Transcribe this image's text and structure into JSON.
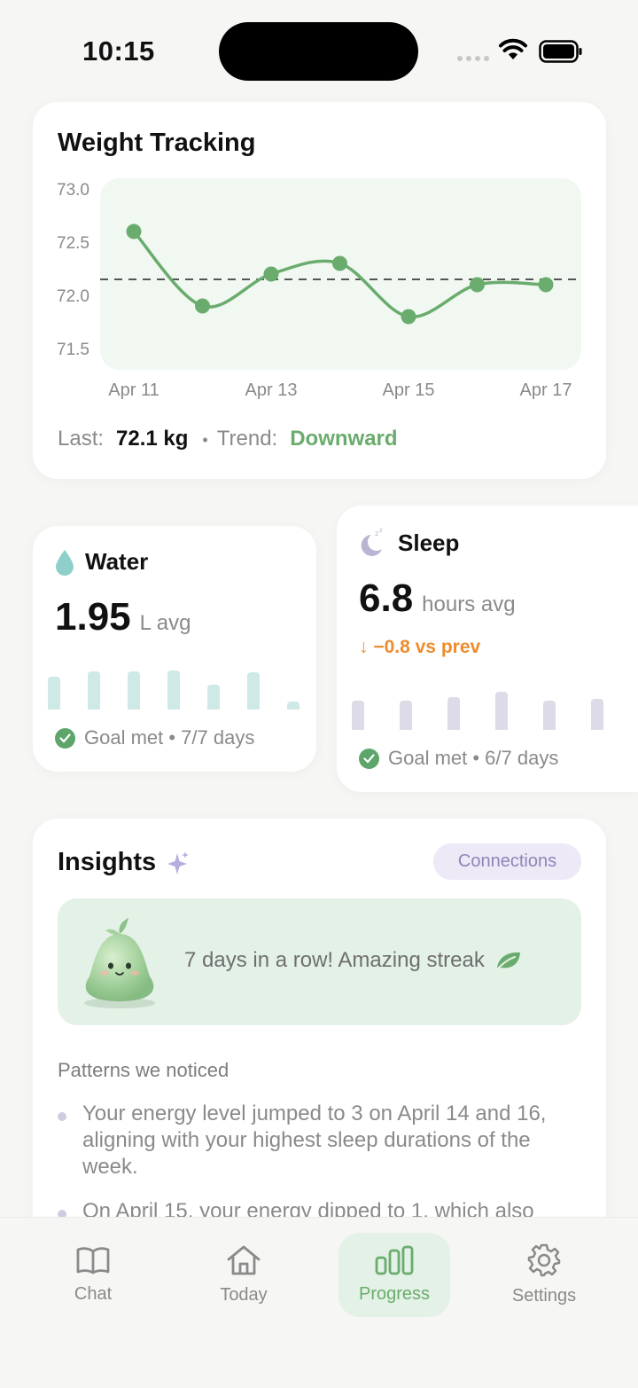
{
  "status_bar": {
    "time": "10:15"
  },
  "weight_card": {
    "title": "Weight Tracking",
    "summary": {
      "last_label": "Last:",
      "last_value": "72.1 kg",
      "trend_label": "Trend:",
      "trend_value": "Downward"
    }
  },
  "chart_data": {
    "type": "line",
    "title": "Weight Tracking",
    "x": [
      "Apr 11",
      "Apr 12",
      "Apr 13",
      "Apr 14",
      "Apr 15",
      "Apr 16",
      "Apr 17"
    ],
    "x_tick_labels": [
      "Apr 11",
      "Apr 13",
      "Apr 15",
      "Apr 17"
    ],
    "y_tick_labels": [
      "73.0",
      "72.5",
      "72.0",
      "71.5"
    ],
    "values": [
      72.6,
      71.9,
      72.2,
      72.3,
      71.8,
      72.1,
      72.1
    ],
    "reference_line": 72.15,
    "ylim": [
      71.5,
      73.0
    ],
    "grid": false,
    "line_color": "#6aac6d"
  },
  "water": {
    "name": "Water",
    "value": "1.95",
    "unit": "L avg",
    "goal": "Goal met • 7/7 days",
    "bar_fractions": [
      0.53,
      0.62,
      0.62,
      0.63,
      0.4,
      0.6,
      0.13
    ],
    "color": "#cfe9e6"
  },
  "sleep": {
    "name": "Sleep",
    "value": "6.8",
    "unit": "hours avg",
    "delta": "↓ −0.8 vs prev",
    "goal": "Goal met • 6/7 days",
    "bar_fractions": [
      0.47,
      0.47,
      0.53,
      0.62,
      0.47,
      0.5
    ],
    "color": "#dcdbe7"
  },
  "insights": {
    "title": "Insights",
    "connections_label": "Connections",
    "streak_text": "7 days in a row! Amazing streak",
    "patterns_label": "Patterns we noticed",
    "patterns": [
      "Your energy level jumped to 3 on April 14 and 16, aligning with your highest sleep durations of the week.",
      "On April 15, your energy dipped to 1, which also"
    ]
  },
  "tabs": [
    {
      "label": "Chat",
      "icon": "book-icon"
    },
    {
      "label": "Today",
      "icon": "home-icon"
    },
    {
      "label": "Progress",
      "icon": "bar-chart-icon"
    },
    {
      "label": "Settings",
      "icon": "gear-icon"
    }
  ],
  "colors": {
    "accent": "#6aac6d",
    "warning": "#ee8c2e",
    "background": "#f6f6f4"
  }
}
